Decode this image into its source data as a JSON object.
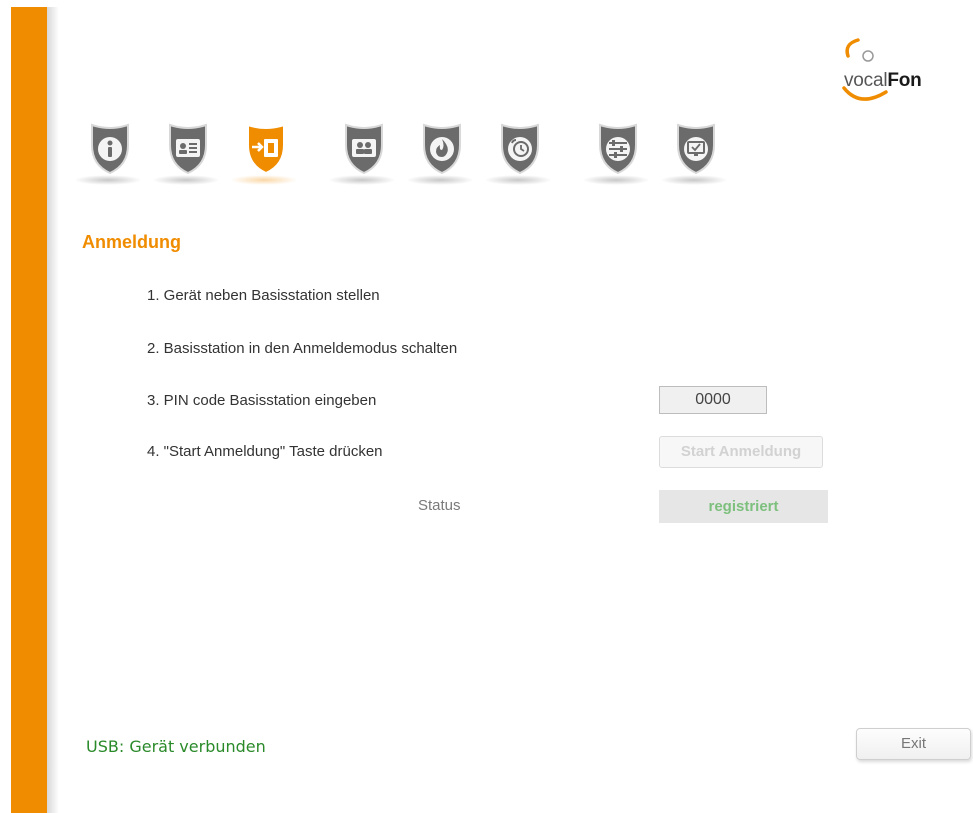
{
  "logo": {
    "part1": "vocal",
    "part2": "Fon"
  },
  "colors": {
    "accent": "#f08c00",
    "icon_gray": "#6b6b6b",
    "status_green": "#7dc07d",
    "usb_green": "#2a8a2a"
  },
  "nav": {
    "tabs": [
      {
        "icon": "info-icon",
        "active": false
      },
      {
        "icon": "contact-card-icon",
        "active": false
      },
      {
        "icon": "registration-icon",
        "active": true
      },
      {
        "icon": "contacts-group-icon",
        "active": false
      },
      {
        "icon": "fire-icon",
        "active": false
      },
      {
        "icon": "alarm-clock-icon",
        "active": false
      },
      {
        "icon": "sliders-icon",
        "active": false
      },
      {
        "icon": "monitor-check-icon",
        "active": false
      }
    ]
  },
  "main": {
    "title": "Anmeldung",
    "steps": [
      "1. Gerät neben Basisstation stellen",
      "2. Basisstation in den Anmeldemodus schalten",
      "3. PIN code Basisstation eingeben",
      "4. \"Start Anmeldung\" Taste drücken"
    ],
    "pin_value": "0000",
    "start_button": "Start Anmeldung",
    "status_label": "Status",
    "status_value": "registriert"
  },
  "footer": {
    "usb_status": "USB: Gerät verbunden",
    "exit_button": "Exit"
  }
}
